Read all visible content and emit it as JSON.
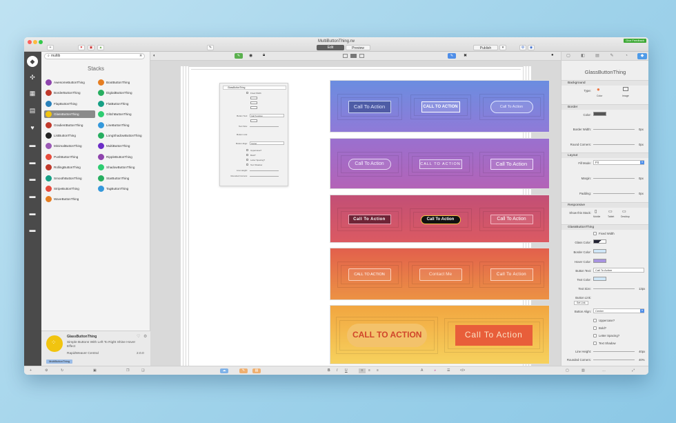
{
  "window": {
    "title": "MultiButtonThing.rw",
    "edit_label": "Edit",
    "preview_label": "Preview",
    "publish_label": "Publish",
    "feedback_label": "Give Feedback"
  },
  "library": {
    "search_value": "multib",
    "title": "Stacks",
    "items": [
      {
        "label": "AwesomeButtonThing",
        "color": "#8e44ad"
      },
      {
        "label": "BootButtonThing",
        "color": "#e67e22"
      },
      {
        "label": "BorderButtonThing",
        "color": "#c0392b"
      },
      {
        "label": "DigitalButtonThing",
        "color": "#27ae60"
      },
      {
        "label": "FlapButtonThing",
        "color": "#2980b9"
      },
      {
        "label": "FlatButtonThing",
        "color": "#16a085"
      },
      {
        "label": "GlassButtonThing",
        "color": "#f1c40f"
      },
      {
        "label": "GlitchButtonThing",
        "color": "#2ecc71"
      },
      {
        "label": "GradientButtonThing",
        "color": "#c0392b"
      },
      {
        "label": "LineButtonThing",
        "color": "#3498db"
      },
      {
        "label": "ListButtonThing",
        "color": "#222222"
      },
      {
        "label": "LongShadowButtonThing",
        "color": "#27ae60"
      },
      {
        "label": "MinimalButtonThing",
        "color": "#9b59b6"
      },
      {
        "label": "MultiButtonThing",
        "color": "#6c2dc7"
      },
      {
        "label": "PushButtonThing",
        "color": "#e74c3c"
      },
      {
        "label": "RippleButtonThing",
        "color": "#8e44ad"
      },
      {
        "label": "RollingButtonThing",
        "color": "#c0392b"
      },
      {
        "label": "ShadowButtonThing",
        "color": "#2ecc71"
      },
      {
        "label": "SmoothButtonThing",
        "color": "#16a085"
      },
      {
        "label": "StarButtonThing",
        "color": "#27ae60"
      },
      {
        "label": "StripeButtonThing",
        "color": "#e74c3c"
      },
      {
        "label": "TagButtonThing",
        "color": "#3498db"
      },
      {
        "label": "WaveButtonThing",
        "color": "#e67e22"
      }
    ],
    "info": {
      "name": "GlassButtonThing",
      "description": "Simple Buttons With Left To Right Shine Hover Effect",
      "author": "RapidWeaver Central",
      "version": "2.0.0",
      "tag": "MultiButtonThing"
    }
  },
  "inspector": {
    "title": "GlassButtonThing",
    "background_header": "Background",
    "type_label": "Type:",
    "type_color": "Color",
    "type_image": "Image",
    "border_header": "Border",
    "color_label": "Color:",
    "border_width_label": "Border Width:",
    "border_width_value": "0px",
    "round_corners_label": "Round Corners:",
    "round_corners_value": "0px",
    "layout_header": "Layout",
    "fill_mode_label": "Fill Mode:",
    "fill_mode_value": "Fit",
    "margin_label": "Margin:",
    "margin_value": "0px",
    "padding_label": "Padding:",
    "padding_value": "0px",
    "responsive_header": "Responsive",
    "show_stack_label": "Show this Stack:",
    "devices": [
      "Mobile",
      "Tablet",
      "Desktop"
    ],
    "stack_header": "GlassButtonThing",
    "fixed_width": "Fixed Width",
    "glass_color": "Glass Color:",
    "border_color": "Border Color:",
    "hover_color": "Hover Color:",
    "button_text_label": "Button Text:",
    "button_text_value": "Call To Action",
    "text_color": "Text Color:",
    "text_size": "Text Size:",
    "text_size_value": "13px",
    "button_link": "Button Link:",
    "button_link_value": "Set Link",
    "button_align": "Button Align:",
    "button_align_value": "Center",
    "uppercase": "Uppercase?",
    "bold": "Bold?",
    "letter_spacing": "Letter Spacing?",
    "text_shadow": "Text Shadow",
    "line_height": "Line Height:",
    "line_height_value": "40px",
    "rounded_corners": "Rounded Corners:",
    "rounded_corners_value": "40%"
  },
  "mini_panel": {
    "title": "GlassButtonThing",
    "fixed_width": "Fixed Width",
    "button_text": "Button Text:",
    "button_text_value": "Call To Action",
    "text_size": "Text Size:",
    "button_link": "Button Link:",
    "button_align": "Button Align:",
    "button_align_value": "Center",
    "uppercase": "Uppercase?",
    "bold": "Bold?",
    "letter_spacing": "Letter Spacing?",
    "text_shadow": "Text Shadow",
    "line_height": "Line Height:",
    "rounded_corners": "Rounded Corners:"
  },
  "rows": [
    {
      "bg": "linear-gradient(180deg,#6b8de0,#8f7ad8)",
      "buttons": [
        "Call To Action",
        "CALL TO ACTION",
        "Call To Action"
      ]
    },
    {
      "bg": "linear-gradient(180deg,#9a70cf,#b363b7)",
      "buttons": [
        "Call To Action",
        "CALL TO ACTION",
        "Call To Action"
      ]
    },
    {
      "bg": "linear-gradient(180deg,#c24f76,#db5a62)",
      "buttons": [
        "Call To Action",
        "Call To Action",
        "Call To Action"
      ]
    },
    {
      "bg": "linear-gradient(180deg,#e2604c,#ec9244)",
      "buttons": [
        "CALL TO ACTION",
        "Contact Me",
        "Call To Action"
      ]
    },
    {
      "bg": "linear-gradient(180deg,#f2a640,#f6d15d)",
      "buttons": [
        "CALL TO ACTION",
        "Call To Action"
      ]
    }
  ]
}
